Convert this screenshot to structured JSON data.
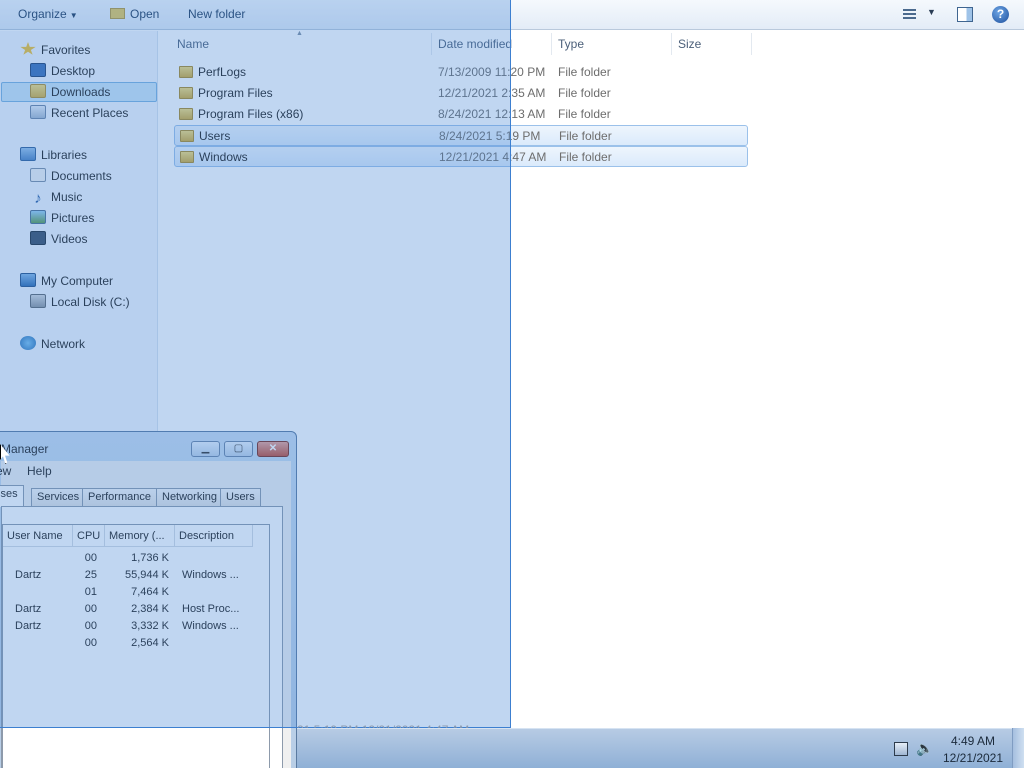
{
  "toolbar": {
    "organize_label": "Organize",
    "open_label": "Open",
    "new_folder_label": "New folder"
  },
  "nav": {
    "favorites": "Favorites",
    "desktop": "Desktop",
    "downloads": "Downloads",
    "recent_places": "Recent Places",
    "libraries": "Libraries",
    "documents": "Documents",
    "music": "Music",
    "pictures": "Pictures",
    "videos": "Videos",
    "my_computer": "My Computer",
    "local_disk": "Local Disk (C:)",
    "network": "Network"
  },
  "columns": {
    "name": "Name",
    "date_modified": "Date modified",
    "type": "Type",
    "size": "Size"
  },
  "files": [
    {
      "name": "PerfLogs",
      "date": "7/13/2009 11:20 PM",
      "type": "File folder",
      "selected": false
    },
    {
      "name": "Program Files",
      "date": "12/21/2021 2:35 AM",
      "type": "File folder",
      "selected": false
    },
    {
      "name": "Program Files (x86)",
      "date": "8/24/2021 12:13 AM",
      "type": "File folder",
      "selected": false
    },
    {
      "name": "Users",
      "date": "8/24/2021 5:19 PM",
      "type": "File folder",
      "selected": true
    },
    {
      "name": "Windows",
      "date": "12/21/2021 4:47 AM",
      "type": "File folder",
      "selected": true
    }
  ],
  "task_manager": {
    "title": "Manager",
    "menu": [
      "ew",
      "Help"
    ],
    "tabs": [
      "sses",
      "Services",
      "Performance",
      "Networking",
      "Users"
    ],
    "active_tab": "sses",
    "columns": [
      "User Name",
      "CPU",
      "Memory (...",
      "Description"
    ],
    "rows": [
      {
        "user": "",
        "cpu": "00",
        "memory": "1,736 K",
        "description": ""
      },
      {
        "user": "Dartz",
        "cpu": "25",
        "memory": "55,944 K",
        "description": "Windows ..."
      },
      {
        "user": "",
        "cpu": "01",
        "memory": "7,464 K",
        "description": ""
      },
      {
        "user": "Dartz",
        "cpu": "00",
        "memory": "2,384 K",
        "description": "Host Proc..."
      },
      {
        "user": "Dartz",
        "cpu": "00",
        "memory": "3,332 K",
        "description": "Windows ..."
      },
      {
        "user": "",
        "cpu": "00",
        "memory": "2,564 K",
        "description": ""
      }
    ]
  },
  "status_ghost": "21 5:19 PM   12/21/2021 4:47 AM",
  "clock": {
    "time": "4:49 AM",
    "date": "12/21/2021"
  },
  "colors": {
    "selection_overlay": "#4083d6",
    "nav_background": "#f3f7fc",
    "taskbar": "#9fbbdd"
  }
}
